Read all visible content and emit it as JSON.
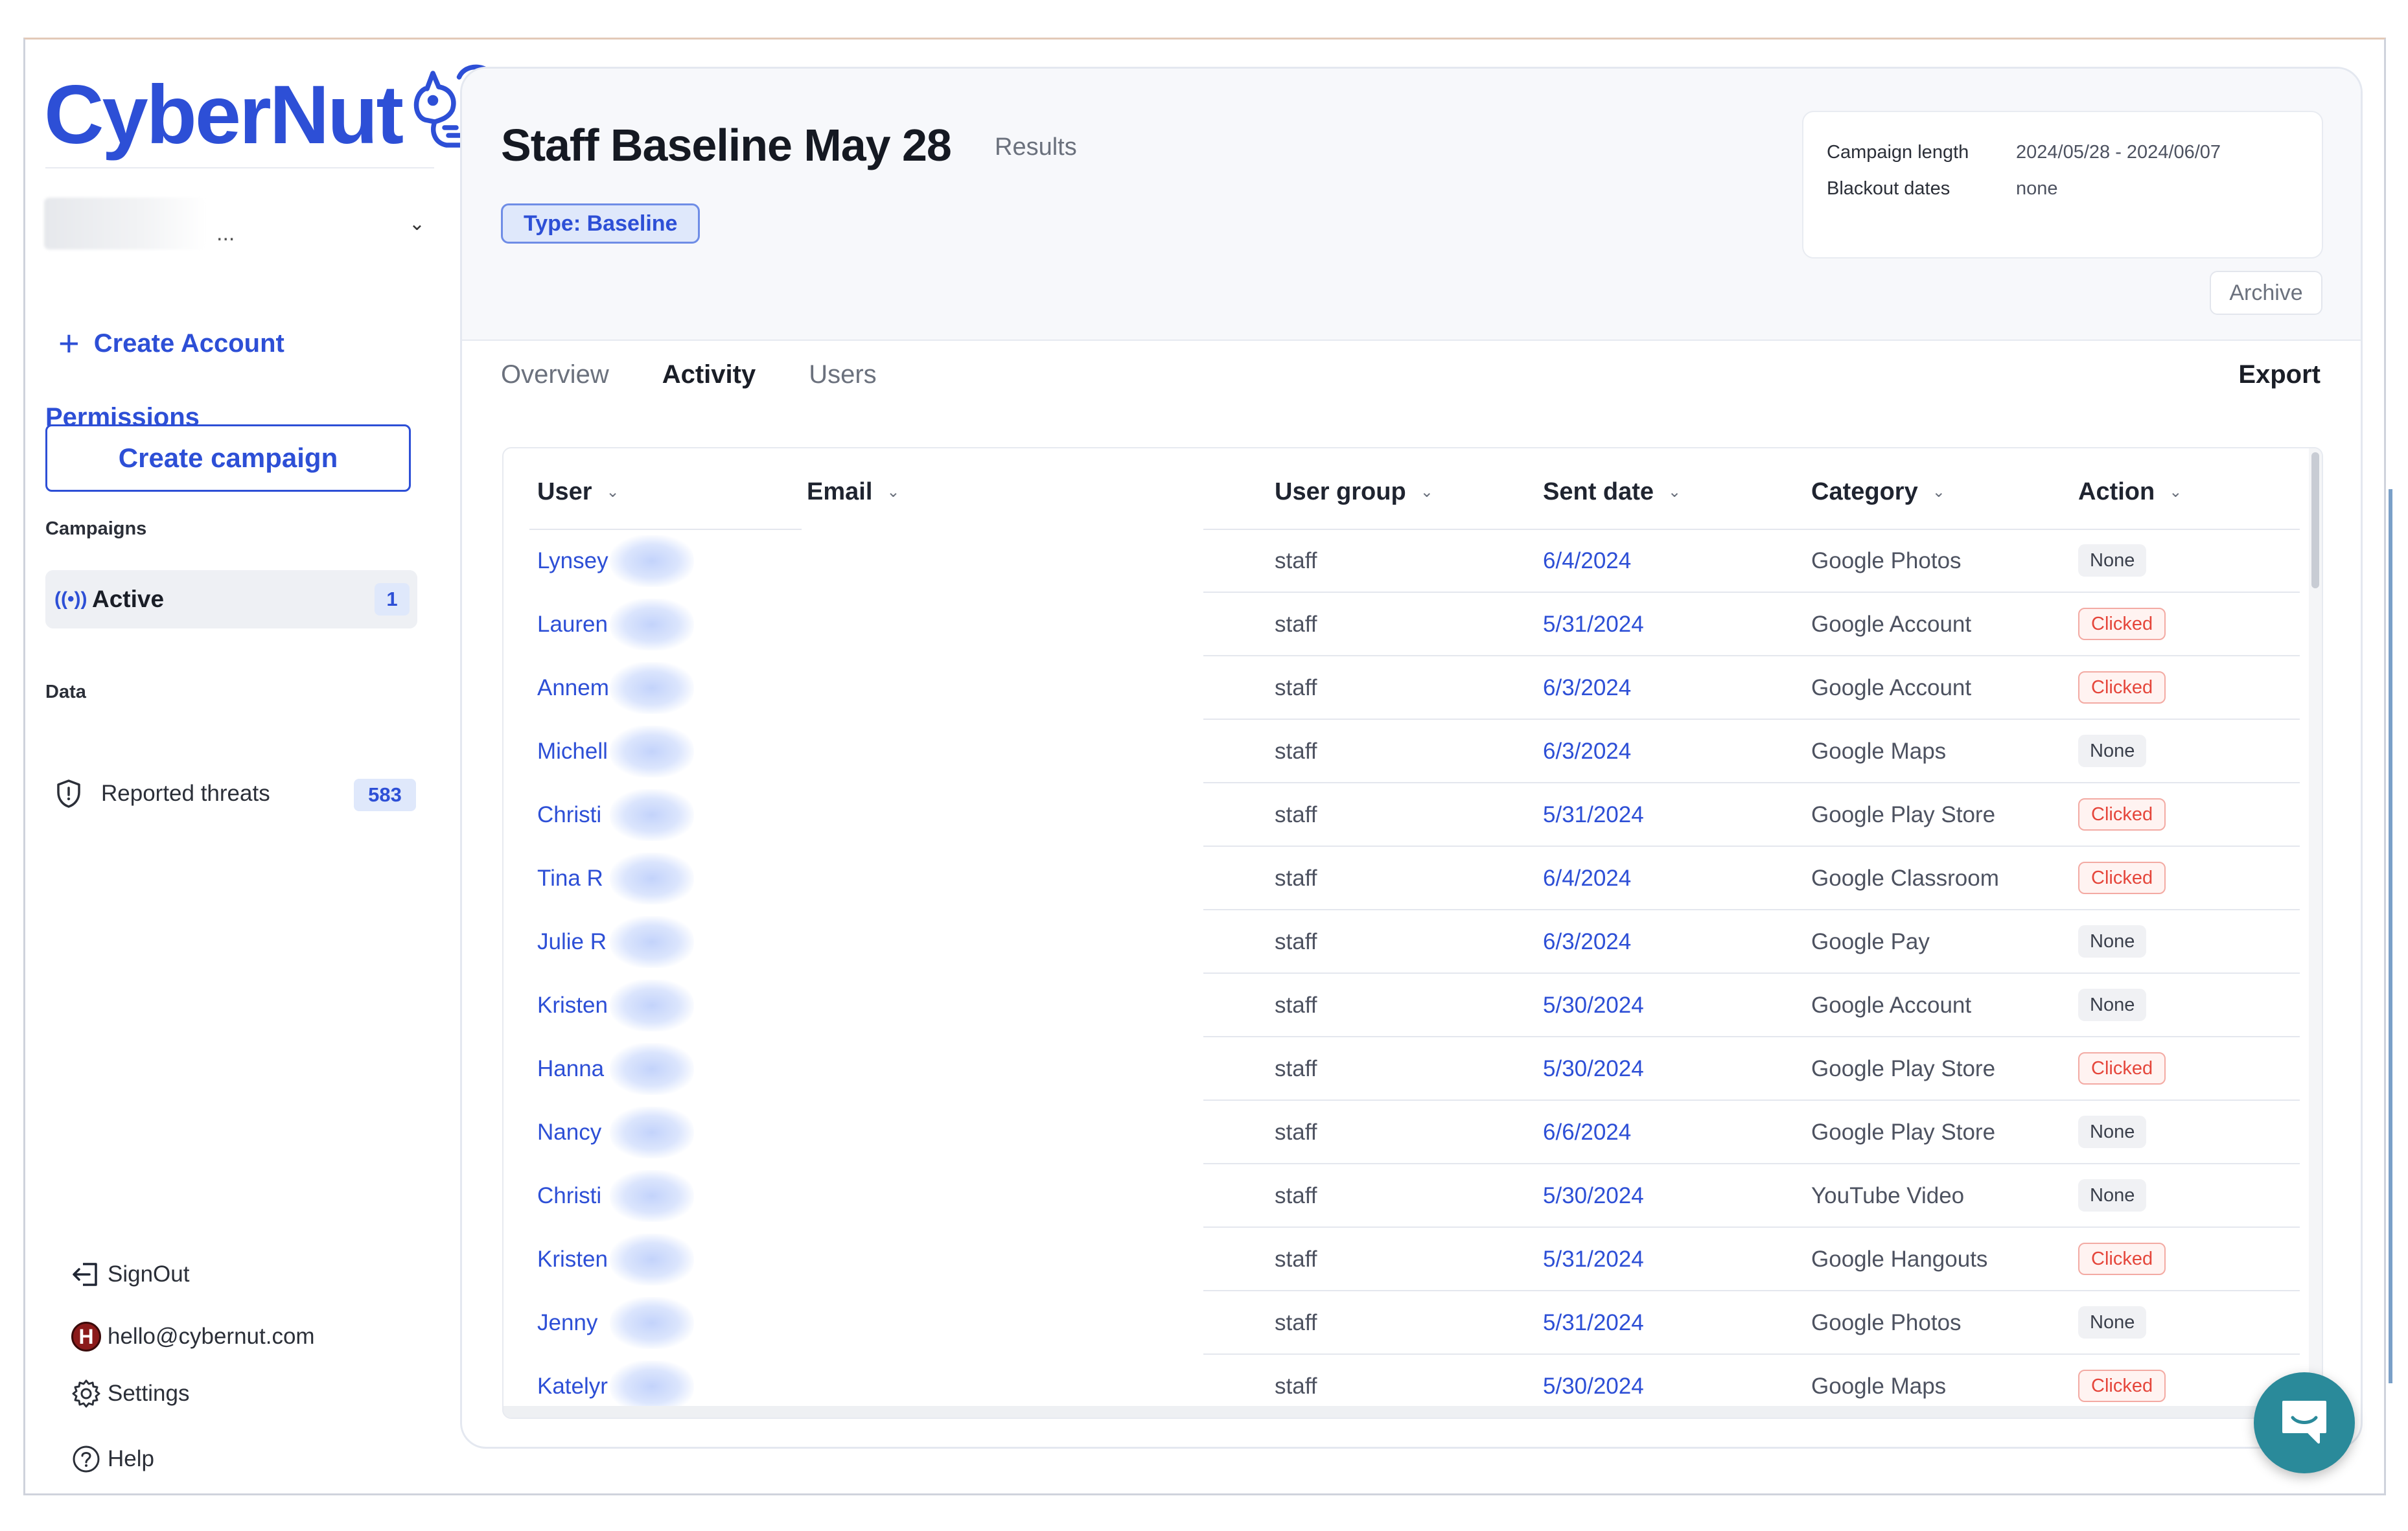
{
  "brand": {
    "logo_text": "CyberNut",
    "accent": "#2d4fd6"
  },
  "sidebar": {
    "account_select": {
      "value": "...",
      "icon": "chevron-down-icon"
    },
    "create_account": "Create Account",
    "permissions": "Permissions",
    "create_campaign": "Create campaign",
    "campaigns_label": "Campaigns",
    "campaigns": [
      {
        "label": "Active",
        "count": "1",
        "icon": "broadcast-icon"
      }
    ],
    "data_label": "Data",
    "data_items": [
      {
        "label": "Reported threats",
        "count": "583",
        "icon": "shield-icon"
      }
    ],
    "bottom": {
      "signout": "SignOut",
      "email": "hello@cybernut.com",
      "avatar_letter": "H",
      "settings": "Settings",
      "help": "Help"
    }
  },
  "campaign": {
    "title": "Staff Baseline May 28",
    "subtitle": "Results",
    "type_badge": "Type: Baseline",
    "info": {
      "length_label": "Campaign length",
      "length_value": "2024/05/28 - 2024/06/07",
      "blackout_label": "Blackout dates",
      "blackout_value": "none"
    },
    "archive": "Archive"
  },
  "tabs": [
    {
      "label": "Overview",
      "active": false
    },
    {
      "label": "Activity",
      "active": true
    },
    {
      "label": "Users",
      "active": false
    }
  ],
  "export": "Export",
  "table": {
    "columns": [
      "User",
      "Email",
      "User group",
      "Sent date",
      "Category",
      "Action"
    ],
    "rows": [
      {
        "user": "Lynsey",
        "group": "staff",
        "date": "6/4/2024",
        "category": "Google Photos",
        "action": "None"
      },
      {
        "user": "Lauren",
        "group": "staff",
        "date": "5/31/2024",
        "category": "Google Account",
        "action": "Clicked"
      },
      {
        "user": "Annem",
        "group": "staff",
        "date": "6/3/2024",
        "category": "Google Account",
        "action": "Clicked"
      },
      {
        "user": "Michell",
        "group": "staff",
        "date": "6/3/2024",
        "category": "Google Maps",
        "action": "None"
      },
      {
        "user": "Christi",
        "group": "staff",
        "date": "5/31/2024",
        "category": "Google Play Store",
        "action": "Clicked"
      },
      {
        "user": "Tina R",
        "group": "staff",
        "date": "6/4/2024",
        "category": "Google Classroom",
        "action": "Clicked"
      },
      {
        "user": "Julie R",
        "group": "staff",
        "date": "6/3/2024",
        "category": "Google Pay",
        "action": "None"
      },
      {
        "user": "Kristen",
        "group": "staff",
        "date": "5/30/2024",
        "category": "Google Account",
        "action": "None"
      },
      {
        "user": "Hanna",
        "group": "staff",
        "date": "5/30/2024",
        "category": "Google Play Store",
        "action": "Clicked"
      },
      {
        "user": "Nancy",
        "group": "staff",
        "date": "6/6/2024",
        "category": "Google Play Store",
        "action": "None"
      },
      {
        "user": "Christi",
        "group": "staff",
        "date": "5/30/2024",
        "category": "YouTube Video",
        "action": "None"
      },
      {
        "user": "Kristen",
        "group": "staff",
        "date": "5/31/2024",
        "category": "Google Hangouts",
        "action": "Clicked"
      },
      {
        "user": "Jenny",
        "group": "staff",
        "date": "5/31/2024",
        "category": "Google Photos",
        "action": "None"
      },
      {
        "user": "Katelyr",
        "group": "staff",
        "date": "5/30/2024",
        "category": "Google Maps",
        "action": "Clicked"
      }
    ]
  },
  "chat_widget": {
    "icon": "chat-icon",
    "color": "#2a8a9a"
  }
}
